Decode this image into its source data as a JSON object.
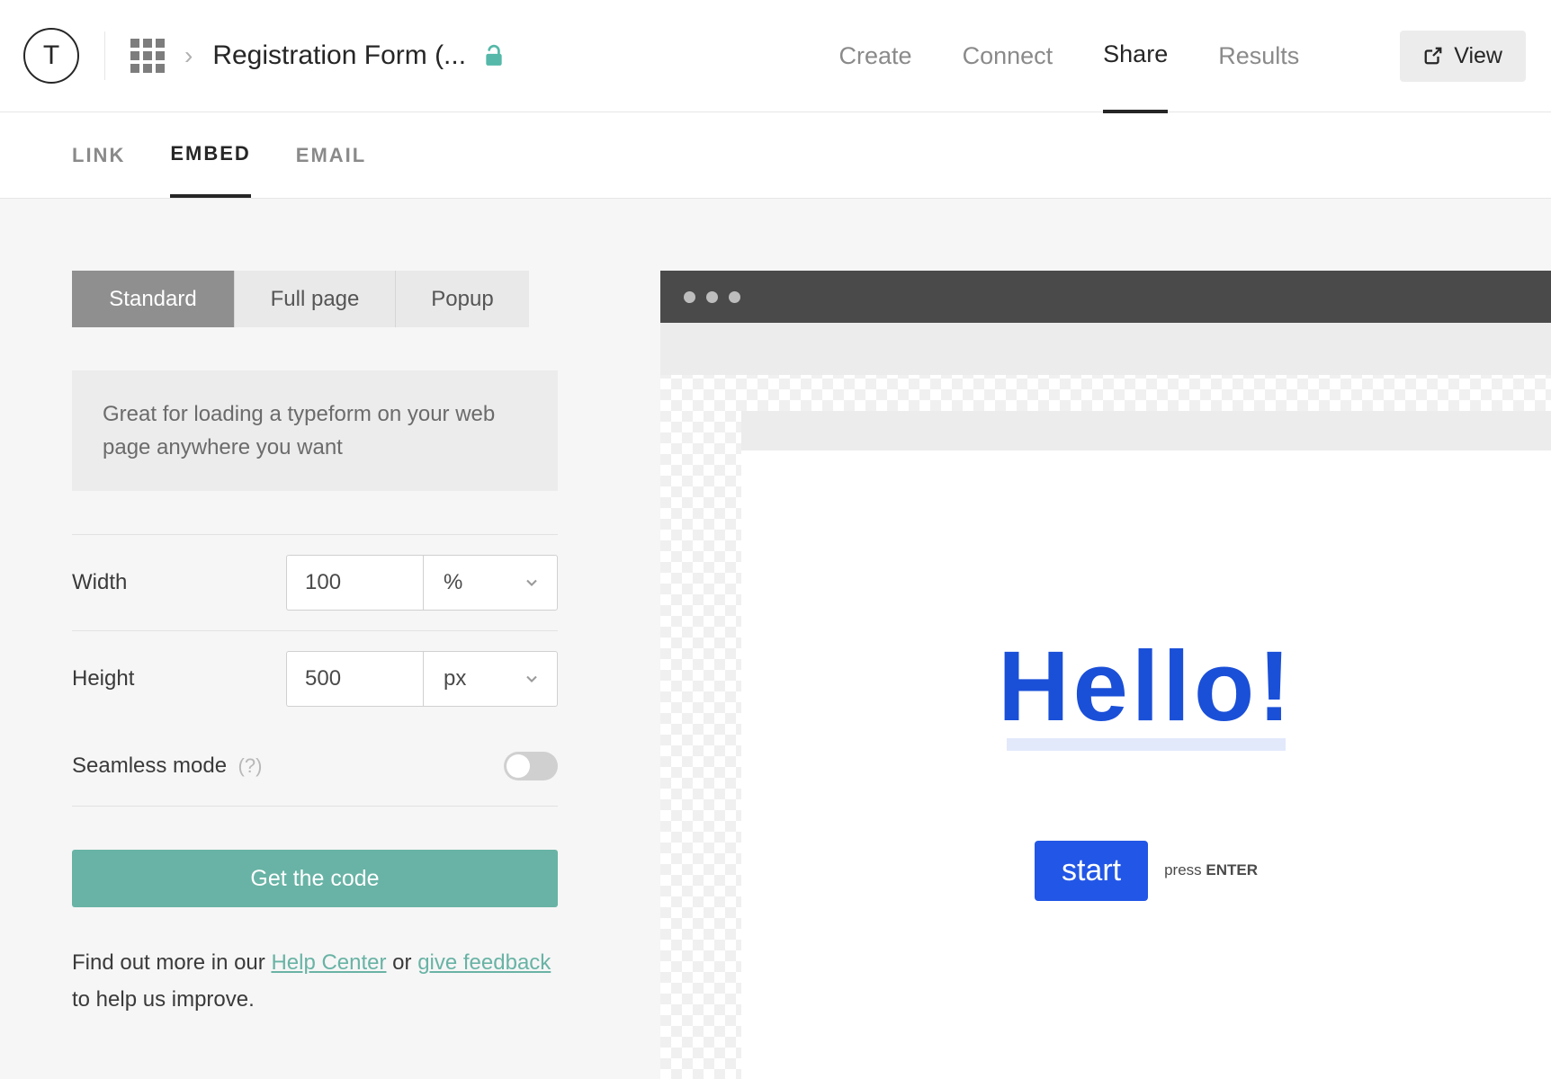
{
  "header": {
    "avatar_letter": "T",
    "form_title": "Registration Form (...",
    "nav": {
      "create": "Create",
      "connect": "Connect",
      "share": "Share",
      "results": "Results",
      "active": "share"
    },
    "view_label": "View"
  },
  "subtabs": {
    "link": "LINK",
    "embed": "EMBED",
    "email": "EMAIL",
    "active": "embed"
  },
  "embed": {
    "types": {
      "standard": "Standard",
      "full_page": "Full page",
      "popup": "Popup",
      "active": "standard"
    },
    "description": "Great for loading a typeform on your web page anywhere you want",
    "width": {
      "label": "Width",
      "value": "100",
      "unit": "%"
    },
    "height": {
      "label": "Height",
      "value": "500",
      "unit": "px"
    },
    "seamless": {
      "label": "Seamless mode",
      "hint": "(?)",
      "enabled": false
    },
    "cta": "Get the code",
    "help": {
      "prefix": "Find out more in our ",
      "help_center": "Help Center",
      "mid": " or ",
      "give_feedback": "give feedback",
      "suffix": " to help us improve."
    }
  },
  "preview": {
    "greeting": "Hello!",
    "start_label": "start",
    "press_prefix": "press ",
    "press_key": "ENTER"
  }
}
